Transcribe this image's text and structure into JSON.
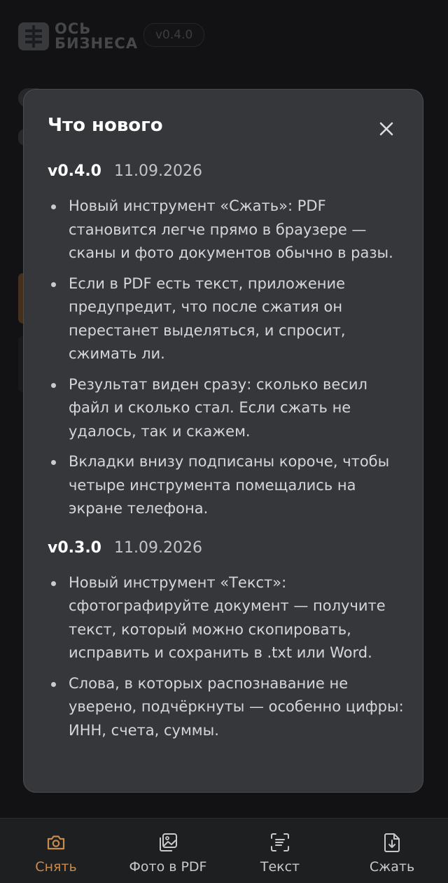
{
  "app": {
    "logo_line1": "ОСЬ",
    "logo_line2": "БИЗНЕСА",
    "version": "v0.4.0"
  },
  "colors": {
    "accent": "#c98a4e",
    "modal_bg": "#35373b",
    "page_bg": "#1c1d1f"
  },
  "modal": {
    "title": "Что нового",
    "close_icon": "close-icon",
    "releases": [
      {
        "version": "v0.4.0",
        "date": "11.09.2026",
        "notes": [
          "Новый инструмент «Сжать»: PDF становится легче прямо в браузере — сканы и фото документов обычно в разы.",
          "Если в PDF есть текст, приложение предупредит, что после сжатия он перестанет выделяться, и спросит, сжимать ли.",
          "Результат виден сразу: сколько весил файл и сколько стал. Если сжать не удалось, так и скажем.",
          "Вкладки внизу подписаны короче, чтобы четыре инструмента помещались на экране телефона."
        ]
      },
      {
        "version": "v0.3.0",
        "date": "11.09.2026",
        "notes": [
          "Новый инструмент «Текст»: сфотографируйте документ — получите текст, который можно скопировать, исправить и сохранить в .txt или Word.",
          "Слова, в которых распознавание не уверено, подчёркнуты — особенно цифры: ИНН, счета, суммы."
        ]
      }
    ]
  },
  "nav": {
    "items": [
      {
        "label": "Снять",
        "icon": "camera-icon",
        "active": true
      },
      {
        "label": "Фото в PDF",
        "icon": "photo-pdf-icon",
        "active": false
      },
      {
        "label": "Текст",
        "icon": "text-scan-icon",
        "active": false
      },
      {
        "label": "Сжать",
        "icon": "compress-file-icon",
        "active": false
      }
    ]
  }
}
